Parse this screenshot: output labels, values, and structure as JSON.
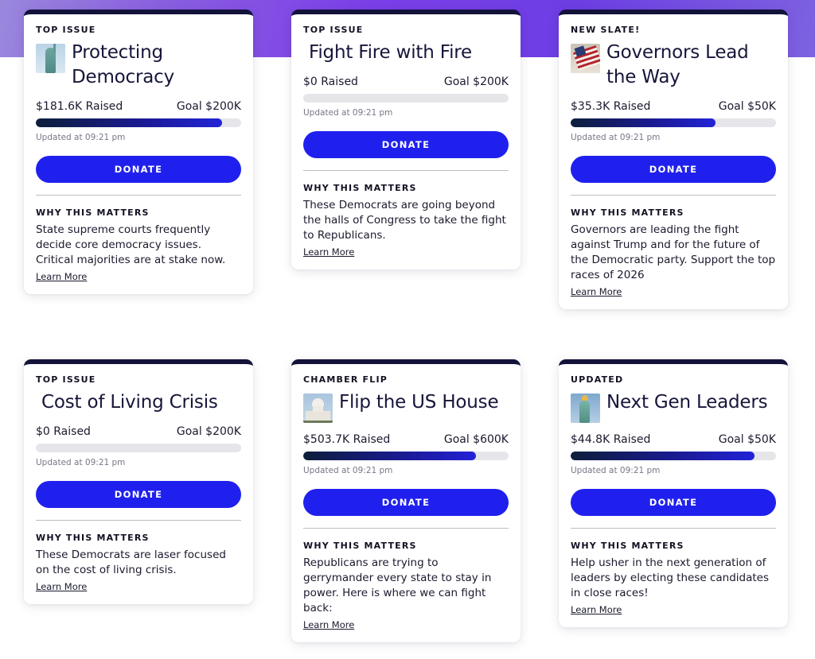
{
  "colors": {
    "hero_gradient": "#7b3fe8",
    "card_border": "#12123a",
    "donate_button": "#2020ee",
    "progress_start": "#0c1f3a",
    "progress_end": "#2323d8",
    "track": "#e6e6ea"
  },
  "cards": [
    {
      "eyebrow": "TOP ISSUE",
      "title": "Protecting Democracy",
      "image": "statue-of-liberty-photo",
      "raised": "$181.6K Raised",
      "goal": "Goal $200K",
      "progress_fraction": 0.908,
      "updated": "Updated at 09:21 pm",
      "donate_label": "DONATE",
      "why_heading": "WHY THIS MATTERS",
      "why_text": "State supreme courts frequently decide core democracy issues. Critical majorities are at stake now.",
      "learn_more": "Learn More"
    },
    {
      "eyebrow": "TOP ISSUE",
      "title": "Fight Fire with Fire",
      "image": null,
      "raised": "$0 Raised",
      "goal": "Goal $200K",
      "progress_fraction": 0,
      "updated": "Updated at 09:21 pm",
      "donate_label": "DONATE",
      "why_heading": "WHY THIS MATTERS",
      "why_text": "These Democrats are going beyond the halls of Congress to take the fight to Republicans.",
      "learn_more": "Learn More"
    },
    {
      "eyebrow": "NEW SLATE!",
      "title": "Governors Lead the Way",
      "image": "american-flag-photo",
      "raised": "$35.3K Raised",
      "goal": "Goal $50K",
      "progress_fraction": 0.706,
      "updated": "Updated at 09:21 pm",
      "donate_label": "DONATE",
      "why_heading": "WHY THIS MATTERS",
      "why_text": "Governors are leading the fight against Trump and for the future of the Democratic party. Support the top races of 2026",
      "learn_more": "Learn More"
    },
    {
      "eyebrow": "TOP ISSUE",
      "title": "Cost of Living Crisis",
      "image": null,
      "raised": "$0 Raised",
      "goal": "Goal $200K",
      "progress_fraction": 0,
      "updated": "Updated at 09:21 pm",
      "donate_label": "DONATE",
      "why_heading": "WHY THIS MATTERS",
      "why_text": "These Democrats are laser focused on the cost of living crisis.",
      "learn_more": "Learn More"
    },
    {
      "eyebrow": "CHAMBER FLIP",
      "title": "Flip the US House",
      "image": "us-capitol-photo",
      "raised": "$503.7K Raised",
      "goal": "Goal $600K",
      "progress_fraction": 0.8395,
      "updated": "Updated at 09:21 pm",
      "donate_label": "DONATE",
      "why_heading": "WHY THIS MATTERS",
      "why_text": "Republicans are trying to gerrymander every state to stay in power. Here is where we can fight back:",
      "learn_more": "Learn More"
    },
    {
      "eyebrow": "UPDATED",
      "title": "Next Gen Leaders",
      "image": "statue-of-liberty-torch-photo",
      "raised": "$44.8K Raised",
      "goal": "Goal $50K",
      "progress_fraction": 0.896,
      "updated": "Updated at 09:21 pm",
      "donate_label": "DONATE",
      "why_heading": "WHY THIS MATTERS",
      "why_text": "Help usher in the next generation of leaders by electing these candidates in close races!",
      "learn_more": "Learn More"
    }
  ]
}
